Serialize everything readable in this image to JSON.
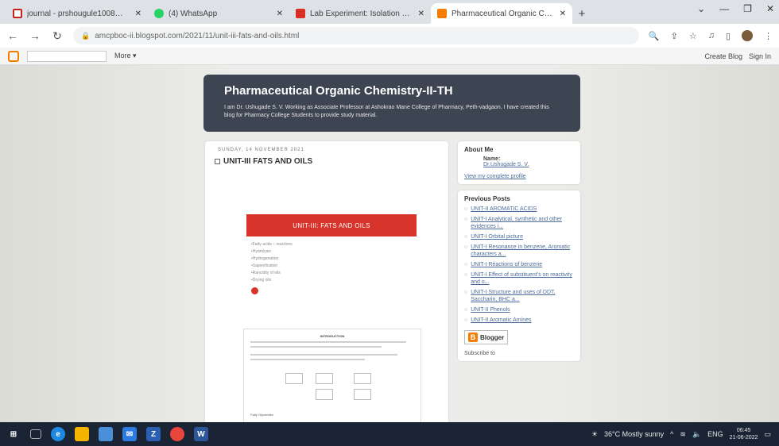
{
  "browser": {
    "tabs": [
      {
        "title": "journal - prshougule1008@gm",
        "color": "#c5221f"
      },
      {
        "title": "(4) WhatsApp",
        "color": "#25d366"
      },
      {
        "title": "Lab Experiment: Isolation and Ic",
        "color": "#d93025"
      },
      {
        "title": "Pharmaceutical Organic Chemi",
        "color": "#f57d00"
      }
    ],
    "url": "amcpboc-ii.blogspot.com/2021/11/unit-iii-fats-and-oils.html"
  },
  "navbar": {
    "more": "More ▾",
    "create_blog": "Create Blog",
    "sign_in": "Sign In"
  },
  "blog": {
    "title": "Pharmaceutical Organic Chemistry-II-TH",
    "description": "I am Dr. Ushugade S. V. Working as Associate Professor at Ashokrao Mane College of Pharmacy, Peth-vadgaon. I have created this blog for Pharmacy College Students to provide study material."
  },
  "post": {
    "date": "SUNDAY, 14 NOVEMBER 2021",
    "title": "UNIT-III FATS AND OILS",
    "slide_title": "UNIT-III: FATS AND OILS",
    "slide_items": [
      "•Fatty acids – reactions",
      "•Hydrolysis",
      "•Hydrogenation",
      "•Saponification",
      "•Rancidity of oils",
      "•Drying oils"
    ],
    "doc_heading": "INTRODUCTION",
    "doc_caption": "Fatty Glycerides"
  },
  "sidebar": {
    "about_title": "About Me",
    "name_label": "Name:",
    "name_value": "Dr.Ushugade S. V.",
    "profile_link": "View my complete profile",
    "previous_title": "Previous Posts",
    "previous_posts": [
      "UNIT-II AROMATIC ACIDS",
      "UNIT-I Analytical, synthetic and other evidences i...",
      "UNIT-I Orbital picture",
      "UNIT-I Resonance in benzene, Aromatic characters a...",
      "UNIT-I Reactions of benzene",
      "UNIT-I Effect of substituent's on reactivity and o...",
      "UNIT-I Structure and uses of DDT, Saccharin, BHC a...",
      "UNIT-II Phenols",
      "UNIT-II Aromatic Amines"
    ],
    "powered_by": "Blogger",
    "subscribe": "Subscribe to"
  },
  "taskbar": {
    "weather": "36°C  Mostly sunny",
    "lang": "ENG",
    "time": "06:45",
    "date": "21-06-2022"
  }
}
